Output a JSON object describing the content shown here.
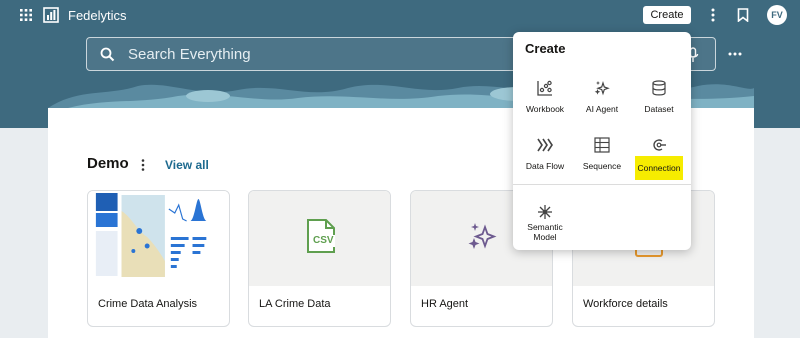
{
  "app": {
    "title": "Fedelytics"
  },
  "topbar": {
    "create_label": "Create",
    "avatar_initials": "FV"
  },
  "search": {
    "placeholder": "Search Everything"
  },
  "section": {
    "title": "Demo",
    "view_all": "View all"
  },
  "cards": [
    {
      "label": "Crime Data Analysis"
    },
    {
      "label": "LA Crime Data",
      "icon_text": "CSV"
    },
    {
      "label": "HR Agent"
    },
    {
      "label": "Workforce details"
    }
  ],
  "create_menu": {
    "title": "Create",
    "items": [
      {
        "label": "Workbook",
        "icon": "workbook-icon"
      },
      {
        "label": "AI Agent",
        "icon": "ai-agent-icon"
      },
      {
        "label": "Dataset",
        "icon": "dataset-icon"
      },
      {
        "label": "Data Flow",
        "icon": "data-flow-icon"
      },
      {
        "label": "Sequence",
        "icon": "sequence-icon"
      },
      {
        "label": "Connection",
        "icon": "connection-icon",
        "highlighted": true
      },
      {
        "label": "Semantic Model",
        "icon": "semantic-model-icon"
      }
    ]
  },
  "colors": {
    "band": "#3e6a7f",
    "highlight": "#f6ec00",
    "link": "#1d6a8f",
    "csv_green": "#5f9f4f",
    "sparkle_purple": "#6d5a8f"
  }
}
